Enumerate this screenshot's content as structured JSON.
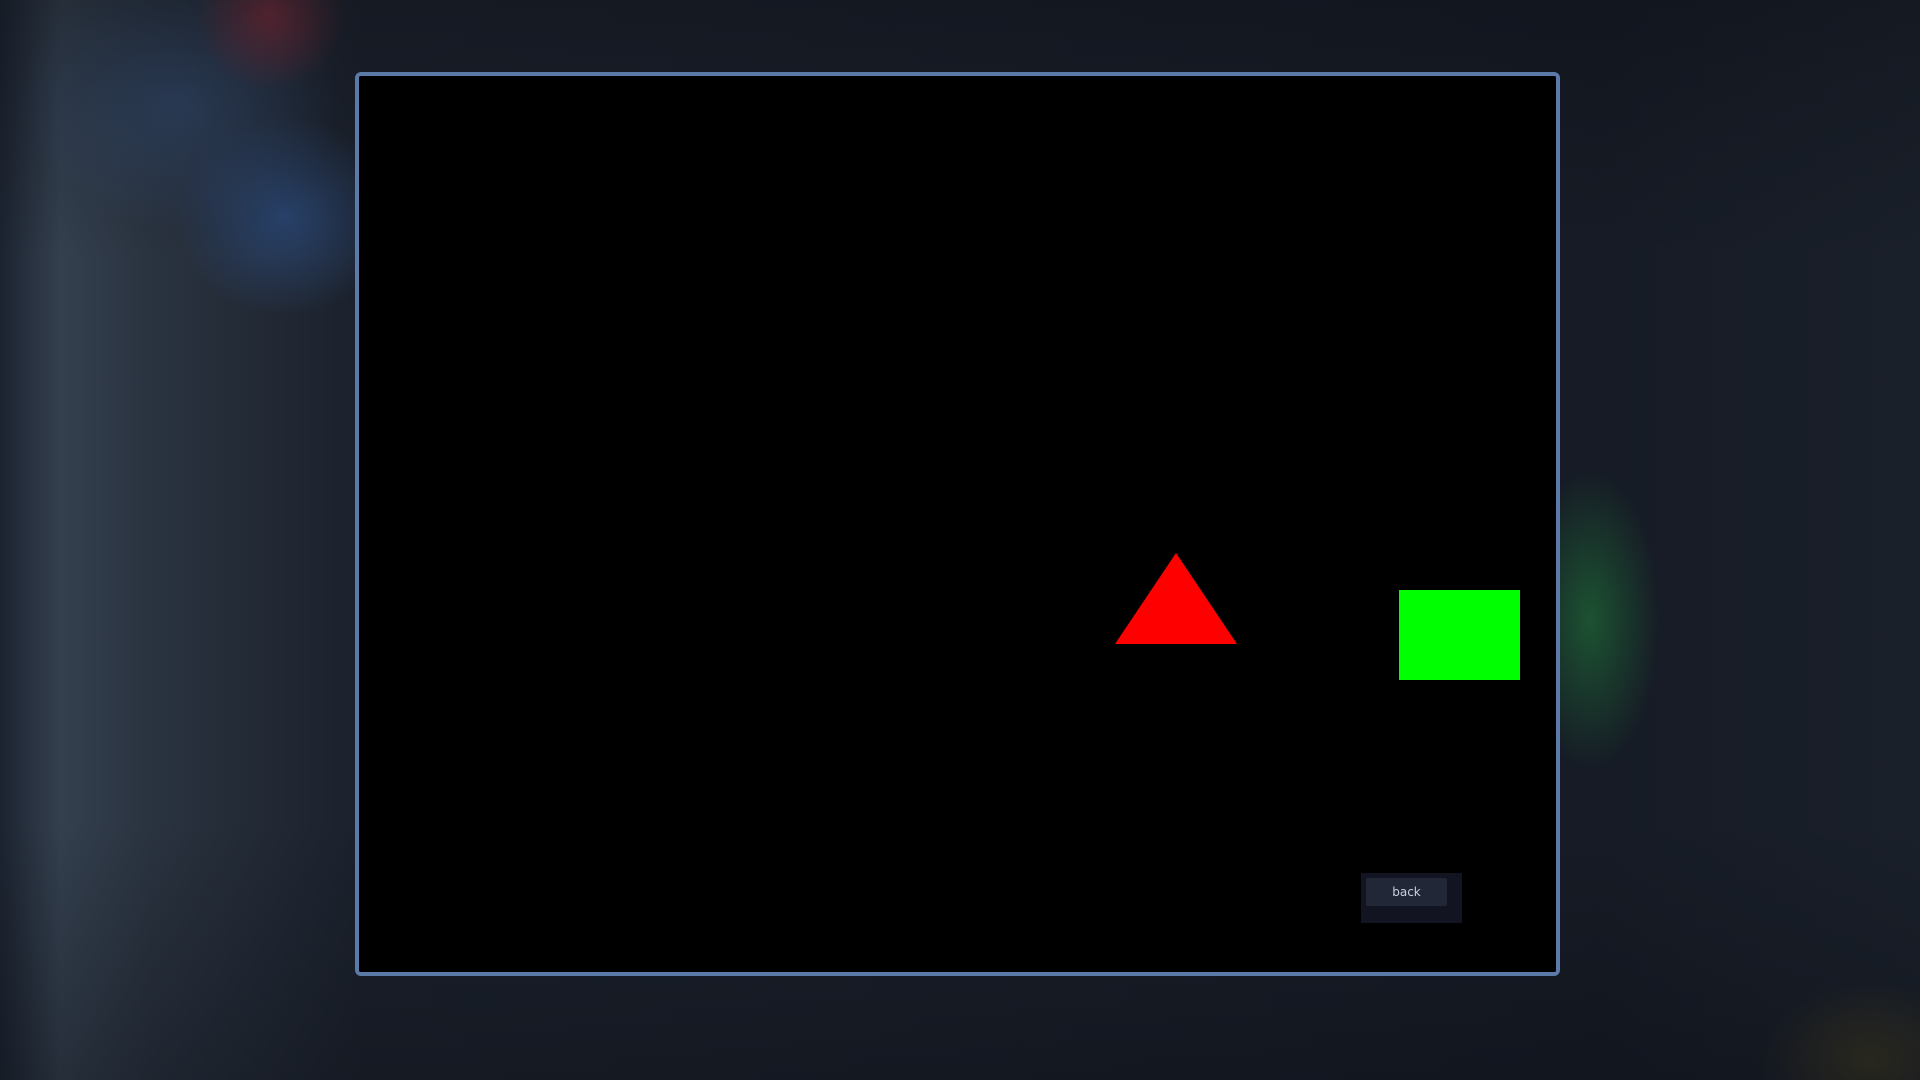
{
  "scene": {
    "background_color": "#000000",
    "frame_border_color": "#5c7aa8",
    "shapes": [
      {
        "shape": "triangle",
        "color": "#ff0000"
      },
      {
        "shape": "square",
        "color": "#00ff00"
      }
    ]
  },
  "controls": {
    "back_label": "back"
  }
}
